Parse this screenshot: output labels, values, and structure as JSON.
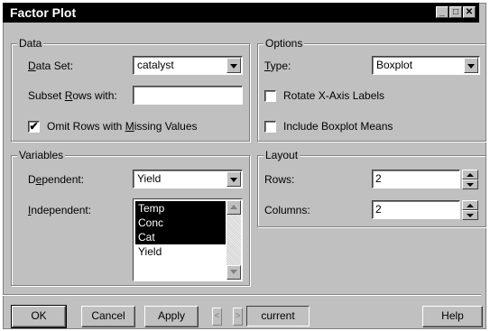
{
  "window": {
    "title": "Factor Plot"
  },
  "data_group": {
    "title": "Data",
    "data_set_label_pre": "",
    "data_set_label_u": "D",
    "data_set_label_post": "ata Set:",
    "data_set_value": "catalyst",
    "subset_label_pre": "Subset ",
    "subset_label_u": "R",
    "subset_label_post": "ows with:",
    "subset_value": "",
    "omit_label_pre": "Omit Rows with ",
    "omit_label_u": "M",
    "omit_label_post": "issing Values",
    "omit_checked": "✔"
  },
  "options_group": {
    "title": "Options",
    "type_label_u": "T",
    "type_label_post": "ype:",
    "type_value": "Boxplot",
    "rotate_label": "Rotate X-Axis Labels",
    "means_label": "Include Boxplot Means"
  },
  "variables_group": {
    "title": "Variables",
    "dependent_label_pre": "D",
    "dependent_label_u": "e",
    "dependent_label_post": "pendent:",
    "dependent_value": "Yield",
    "independent_label_u": "I",
    "independent_label_post": "ndependent:",
    "independent_items": [
      {
        "label": "Temp",
        "selected": true
      },
      {
        "label": "Conc",
        "selected": true
      },
      {
        "label": "Cat",
        "selected": true
      },
      {
        "label": "Yield",
        "selected": false
      }
    ]
  },
  "layout_group": {
    "title": "Layout",
    "rows_label": "Rows:",
    "rows_value": "2",
    "columns_label": "Columns:",
    "columns_value": "2"
  },
  "buttons": {
    "ok": "OK",
    "cancel": "Cancel",
    "apply": "Apply",
    "prev": "<",
    "next": ">",
    "current": "current",
    "help": "Help"
  }
}
